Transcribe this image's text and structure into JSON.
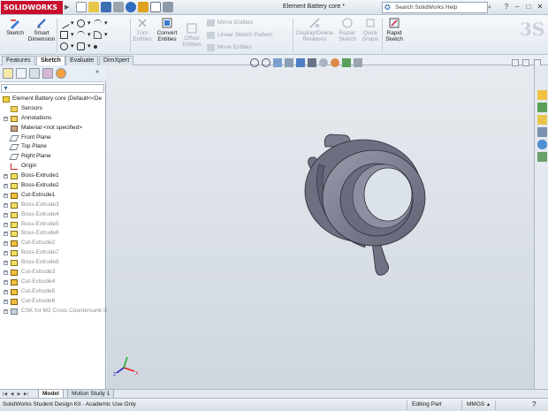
{
  "app": {
    "logo_text": "SOLIDWORKS",
    "document_title": "Element Battery core *",
    "search_placeholder": "Search SolidWorks Help"
  },
  "ribbon": {
    "sketch": "Sketch",
    "smart_dimension_line1": "Smart",
    "smart_dimension_line2": "Dimension",
    "trim_line1": "Trim",
    "trim_line2": "Entities",
    "convert_line1": "Convert",
    "convert_line2": "Entities",
    "offset_line1": "Offset",
    "offset_line2": "Entities",
    "mirror_entities": "Mirror Entities",
    "linear_sketch_pattern": "Linear Sketch Pattern",
    "move_entities": "Move Entities",
    "display_delete_line1": "Display/Delete",
    "display_delete_line2": "Relations",
    "repair_line1": "Repair",
    "repair_line2": "Sketch",
    "quick_snaps_line1": "Quick",
    "quick_snaps_line2": "Snaps",
    "rapid_sketch_line1": "Rapid",
    "rapid_sketch_line2": "Sketch"
  },
  "tabs": [
    "Features",
    "Sketch",
    "Evaluate",
    "DimXpert"
  ],
  "active_tab": "Sketch",
  "tree": {
    "root": "Element Battery core  (Default<<De",
    "items": [
      {
        "label": "Sensors",
        "icon": "folder-icon",
        "expander": false,
        "dim": false
      },
      {
        "label": "Annotations",
        "icon": "annotation-icon",
        "expander": true,
        "dim": false
      },
      {
        "label": "Material <not specified>",
        "icon": "material-icon",
        "expander": false,
        "dim": false
      },
      {
        "label": "Front Plane",
        "icon": "plane-icon",
        "expander": false,
        "dim": false
      },
      {
        "label": "Top Plane",
        "icon": "plane-icon",
        "expander": false,
        "dim": false
      },
      {
        "label": "Right Plane",
        "icon": "plane-icon",
        "expander": false,
        "dim": false
      },
      {
        "label": "Origin",
        "icon": "origin-icon",
        "expander": false,
        "dim": false
      },
      {
        "label": "Boss-Extrude1",
        "icon": "boss-icon",
        "expander": true,
        "dim": false
      },
      {
        "label": "Boss-Extrude2",
        "icon": "boss-icon",
        "expander": true,
        "dim": false
      },
      {
        "label": "Cut-Extrude1",
        "icon": "cut-icon",
        "expander": true,
        "dim": false
      },
      {
        "label": "Boss-Extrude3",
        "icon": "boss-icon",
        "expander": true,
        "dim": true
      },
      {
        "label": "Boss-Extrude4",
        "icon": "boss-icon",
        "expander": true,
        "dim": true
      },
      {
        "label": "Boss-Extrude5",
        "icon": "boss-icon",
        "expander": true,
        "dim": true
      },
      {
        "label": "Boss-Extrude6",
        "icon": "boss-icon",
        "expander": true,
        "dim": true
      },
      {
        "label": "Cut-Extrude2",
        "icon": "cut-icon",
        "expander": true,
        "dim": true
      },
      {
        "label": "Boss-Extrude7",
        "icon": "boss-icon",
        "expander": true,
        "dim": true
      },
      {
        "label": "Boss-Extrude8",
        "icon": "boss-icon",
        "expander": true,
        "dim": true
      },
      {
        "label": "Cut-Extrude3",
        "icon": "cut-icon",
        "expander": true,
        "dim": true
      },
      {
        "label": "Cut-Extrude4",
        "icon": "cut-icon",
        "expander": true,
        "dim": true
      },
      {
        "label": "Cut-Extrude5",
        "icon": "cut-icon",
        "expander": true,
        "dim": true
      },
      {
        "label": "Cut-Extrude6",
        "icon": "cut-icon",
        "expander": true,
        "dim": true
      },
      {
        "label": "CSK for M2 Cross Countersunk S",
        "icon": "hole-icon",
        "expander": true,
        "dim": true
      }
    ]
  },
  "bottom_tabs": [
    "Model",
    "Motion Study 1"
  ],
  "status": {
    "left": "SolidWorks Student Design Kit - Academic Use Only",
    "mode": "Editing Part",
    "units": "MMGS"
  },
  "colors": {
    "brand_red": "#c8102e",
    "part_gray": "#8a8d9c",
    "graphics_bg": "#dce2e9"
  }
}
